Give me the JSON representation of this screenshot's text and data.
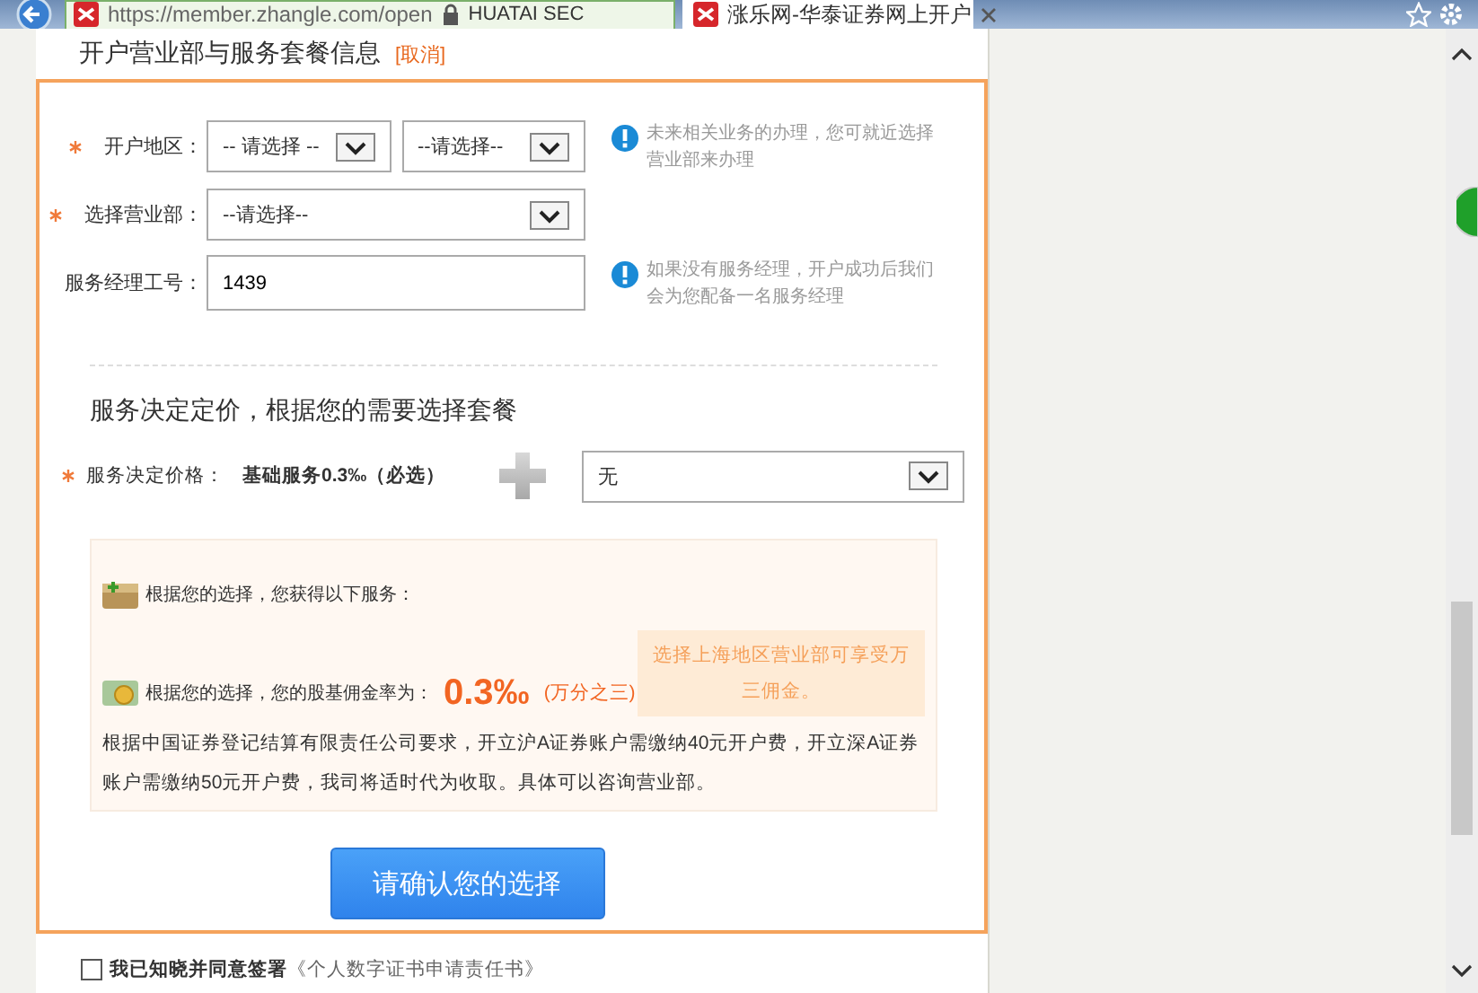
{
  "browser": {
    "url": "https://member.zhangle.com/open",
    "site_identity": "HUATAI SEC",
    "tabs": [
      {
        "label": "涨乐网-华泰证券网上开户",
        "selected": true
      }
    ]
  },
  "header": {
    "title": "开户营业部与服务套餐信息",
    "cancel_link": "[取消]"
  },
  "form": [
    {
      "kind": "select-pair",
      "required": true,
      "label": "开户地区：",
      "values": [
        "-- 请选择 --",
        "--请选择--"
      ],
      "hint": "未来相关业务的办理，您可就近选择营业部来办理"
    },
    {
      "kind": "select",
      "required": true,
      "label": "选择营业部：",
      "values": [
        "--请选择--"
      ]
    },
    {
      "kind": "input",
      "required": false,
      "label": "服务经理工号：",
      "values": [
        "1439"
      ],
      "hint": "如果没有服务经理，开户成功后我们会为您配备一名服务经理"
    }
  ],
  "package": {
    "title": "服务决定定价，根据您的需要选择套餐",
    "required": true,
    "label": "服务决定价格：",
    "base_service": "基础服务0.3‰（必选）",
    "addon_select": "无"
  },
  "summary": {
    "services_line": "根据您的选择，您获得以下服务：",
    "rate_line": "根据您的选择，您的股基佣金率为：",
    "rate": "0.3‰",
    "rate_note": "(万分之三)",
    "promo": "选择上海地区营业部可享受万三佣金。",
    "notice": "根据中国证券登记结算有限责任公司要求，开立沪A证券账户需缴纳40元开户费，开立深A证券账户需缴纳50元开户费，我司将适时代为收取。具体可以咨询营业部。"
  },
  "confirm_button": "请确认您的选择",
  "agreement": {
    "checked": false,
    "text": "我已知晓并同意签署",
    "link": "《个人数字证书申请责任书》"
  }
}
